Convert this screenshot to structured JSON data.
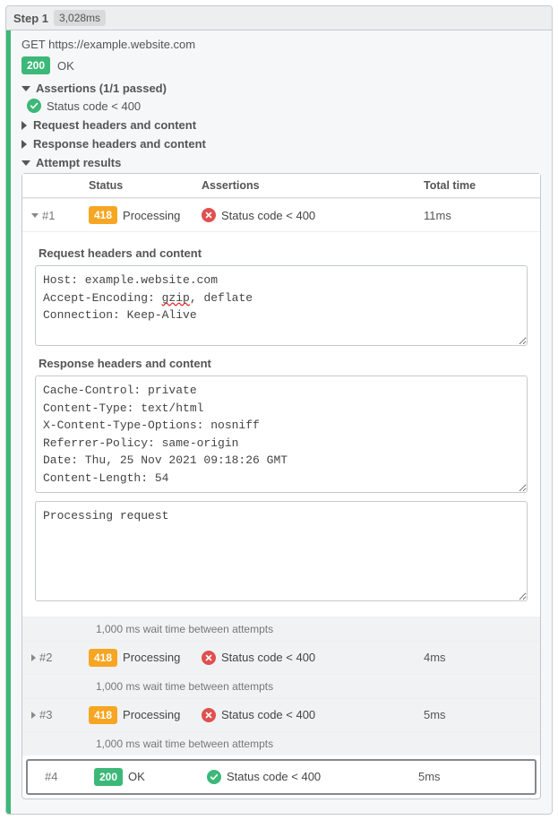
{
  "step": {
    "label": "Step 1",
    "duration": "3,028ms",
    "method_url": "GET https://example.website.com",
    "status_code": "200",
    "status_text": "OK"
  },
  "sections": {
    "assertions_label": "Assertions (1/1 passed)",
    "assertion_text": "Status code < 400",
    "request_headers_label": "Request headers and content",
    "response_headers_label": "Response headers and content",
    "attempt_results_label": "Attempt results"
  },
  "table": {
    "headers": {
      "status": "Status",
      "assertions": "Assertions",
      "total_time": "Total time"
    }
  },
  "attempts": [
    {
      "index": "#1",
      "code": "418",
      "code_text": "Processing",
      "code_color": "orange",
      "assert_pass": false,
      "assert_text": "Status code < 400",
      "time": "11ms",
      "expanded": true,
      "wait_after": "1,000 ms wait time between attempts"
    },
    {
      "index": "#2",
      "code": "418",
      "code_text": "Processing",
      "code_color": "orange",
      "assert_pass": false,
      "assert_text": "Status code < 400",
      "time": "4ms",
      "expanded": false,
      "wait_after": "1,000 ms wait time between attempts"
    },
    {
      "index": "#3",
      "code": "418",
      "code_text": "Processing",
      "code_color": "orange",
      "assert_pass": false,
      "assert_text": "Status code < 400",
      "time": "5ms",
      "expanded": false,
      "wait_after": "1,000 ms wait time between attempts"
    },
    {
      "index": "#4",
      "code": "200",
      "code_text": "OK",
      "code_color": "green",
      "assert_pass": true,
      "assert_text": "Status code < 400",
      "time": "5ms",
      "expanded": false,
      "final": true
    }
  ],
  "detail": {
    "req_label": "Request headers and content",
    "req_pre1": "Host: example.website.com\nAccept-Encoding: ",
    "req_spell": "gzip",
    "req_pre2": ", deflate\nConnection: Keep-Alive",
    "resp_label": "Response headers and content",
    "resp_headers": "Cache-Control: private\nContent-Type: text/html\nX-Content-Type-Options: nosniff\nReferrer-Policy: same-origin\nDate: Thu, 25 Nov 2021 09:18:26 GMT\nContent-Length: 54",
    "resp_body": "Processing request"
  }
}
